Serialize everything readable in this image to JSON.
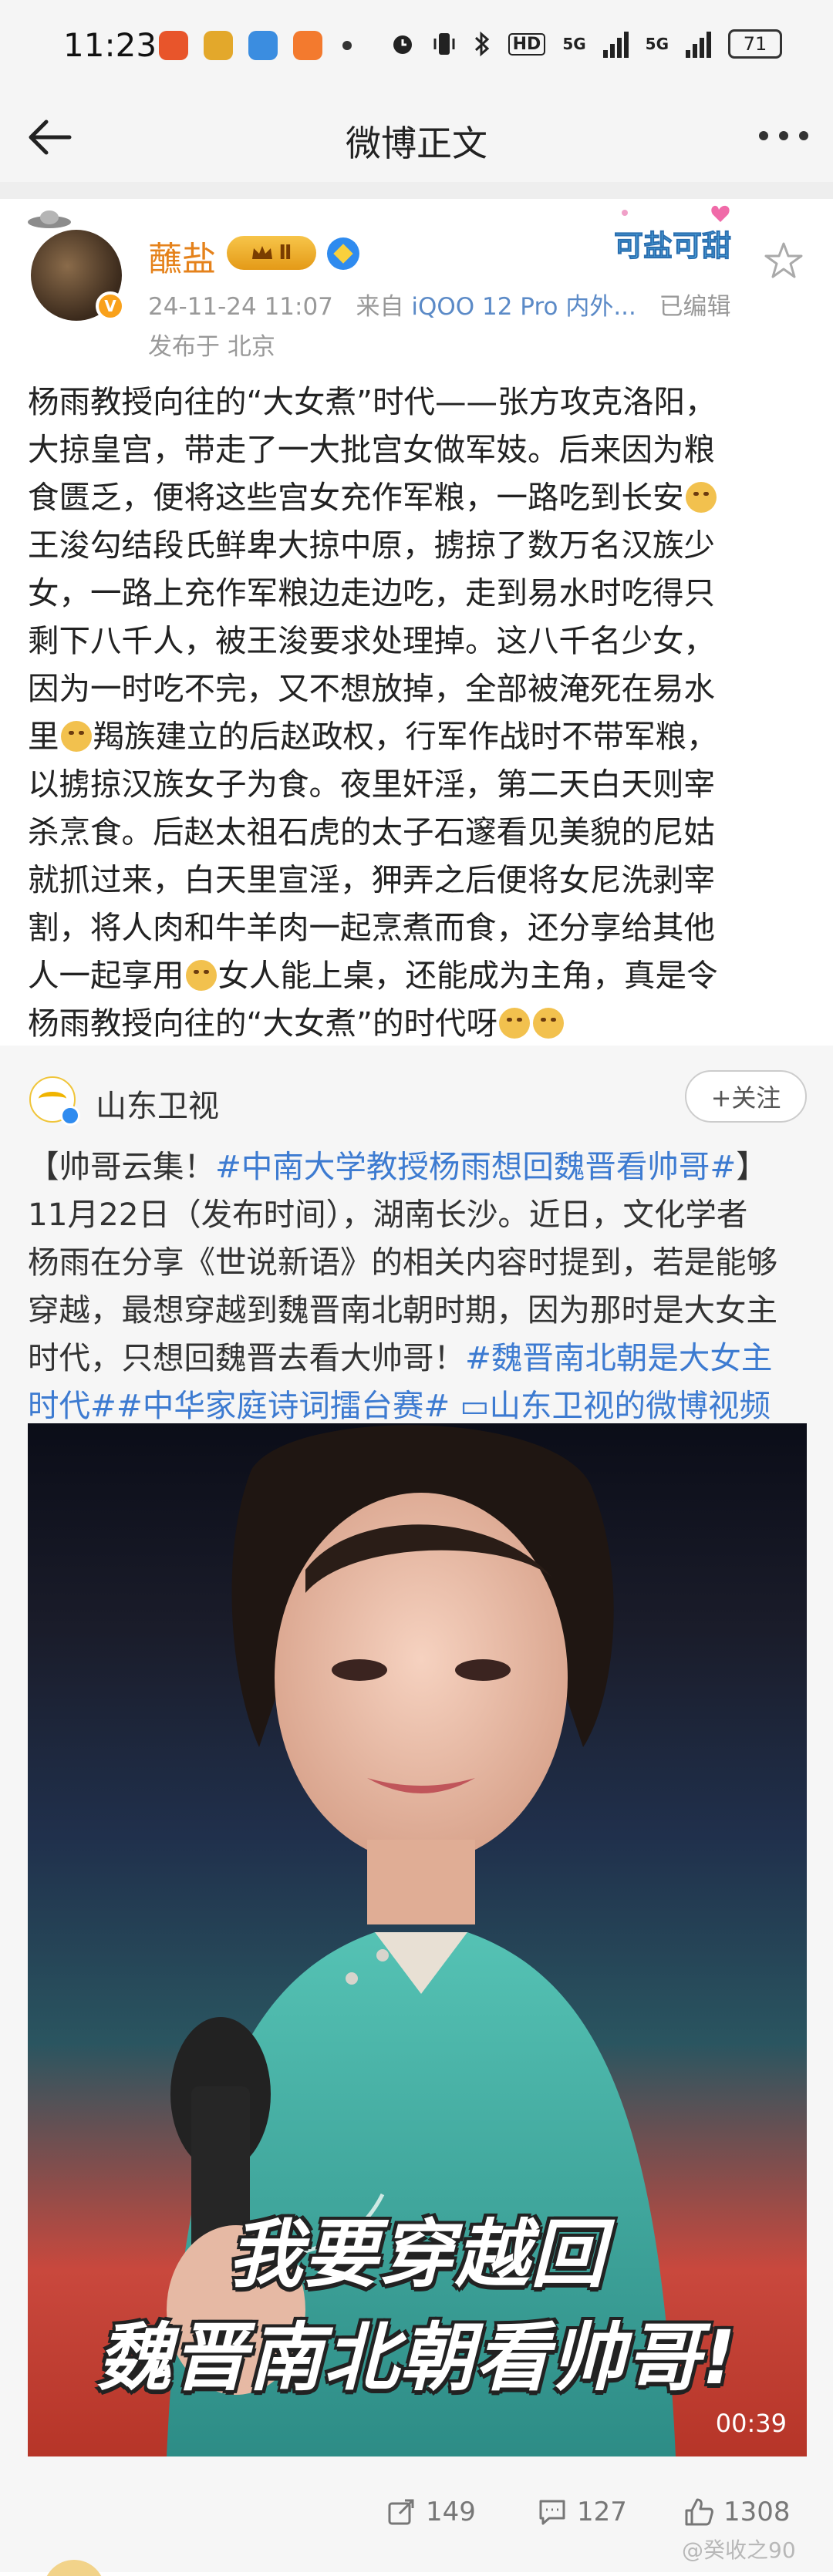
{
  "status_bar": {
    "time": "11:23",
    "apps": [
      {
        "name": "ting-app-icon",
        "color": "#e8552b"
      },
      {
        "name": "amber-app-icon",
        "color": "#e3a82b"
      },
      {
        "name": "blue-app-icon",
        "color": "#3b8de0"
      },
      {
        "name": "orange-app-icon",
        "color": "#f37a2e"
      }
    ],
    "hd_label": "HD",
    "net1": "5G",
    "net2": "5G",
    "battery": "71"
  },
  "title_bar": {
    "title": "微博正文"
  },
  "post": {
    "username": "蘸盐",
    "crown_badge": "Ⅱ",
    "verified_badge": "V",
    "date": "24-11-24 11:07",
    "source_prefix": "来自",
    "source": "iQOO 12 Pro 内外...",
    "edited": "已编辑",
    "location": "发布于 北京",
    "sticker_text": "可盐可甜",
    "body_lines": [
      [
        "杨雨教授向往的“大女煮”时代——张方攻克洛阳，"
      ],
      [
        "大掠皇宫，带走了一大批宫女做军妓。后来因为粮"
      ],
      [
        "食匮乏，便将这些宫女充作军粮，一路吃到长安",
        "E"
      ],
      [
        "王浚勾结段氏鲜卑大掠中原，掳掠了数万名汉族少"
      ],
      [
        "女，一路上充作军粮边走边吃，走到易水时吃得只"
      ],
      [
        "剩下八千人，被王浚要求处理掉。这八千名少女，"
      ],
      [
        "因为一时吃不完，又不想放掉，全部被淹死在易水"
      ],
      [
        "里",
        "E",
        "羯族建立的后赵政权，行军作战时不带军粮，"
      ],
      [
        "以掳掠汉族女子为食。夜里奸淫，第二天白天则宰"
      ],
      [
        "杀烹食。后赵太祖石虎的太子石邃看见美貌的尼姑"
      ],
      [
        "就抓过来，白天里宣淫，狎弄之后便将女尼洗剥宰"
      ],
      [
        "割，将人肉和牛羊肉一起烹煮而食，还分享给其他"
      ],
      [
        "人一起享用",
        "E",
        "女人能上桌，还能成为主角，真是令"
      ],
      [
        "杨雨教授向往的“大女煮”的时代呀",
        "E",
        "E"
      ]
    ]
  },
  "repost": {
    "source_name": "山东卫视",
    "follow_label": "+关注",
    "lines": [
      [
        {
          "t": "【帅哥云集！"
        },
        {
          "t": "#中南大学教授杨雨想回魏晋看帅哥#",
          "hl": true
        },
        {
          "t": "】"
        }
      ],
      [
        {
          "t": "11月22日（发布时间），湖南长沙。近日，文化学者"
        }
      ],
      [
        {
          "t": "杨雨在分享《世说新语》的相关内容时提到，若是能够"
        }
      ],
      [
        {
          "t": "穿越，最想穿越到魏晋南北朝时期，因为那时是大女主"
        }
      ],
      [
        {
          "t": "时代，只想回魏晋去看大帅哥！"
        },
        {
          "t": "#魏晋南北朝是大女主",
          "hl": true
        }
      ],
      [
        {
          "t": "时代##中华家庭诗词擂台赛#",
          "hl": true
        },
        {
          "t": " ",
          "hl": true
        },
        {
          "t": "▭山东卫视的微博视频",
          "hl": true
        }
      ]
    ],
    "video": {
      "caption_line1": "我要穿越回",
      "caption_line2": "魏晋南北朝看帅哥!",
      "duration": "00:39"
    }
  },
  "actions": {
    "share_count": "149",
    "comment_count": "127",
    "like_count": "1308",
    "watermark": "@癸收之90"
  }
}
